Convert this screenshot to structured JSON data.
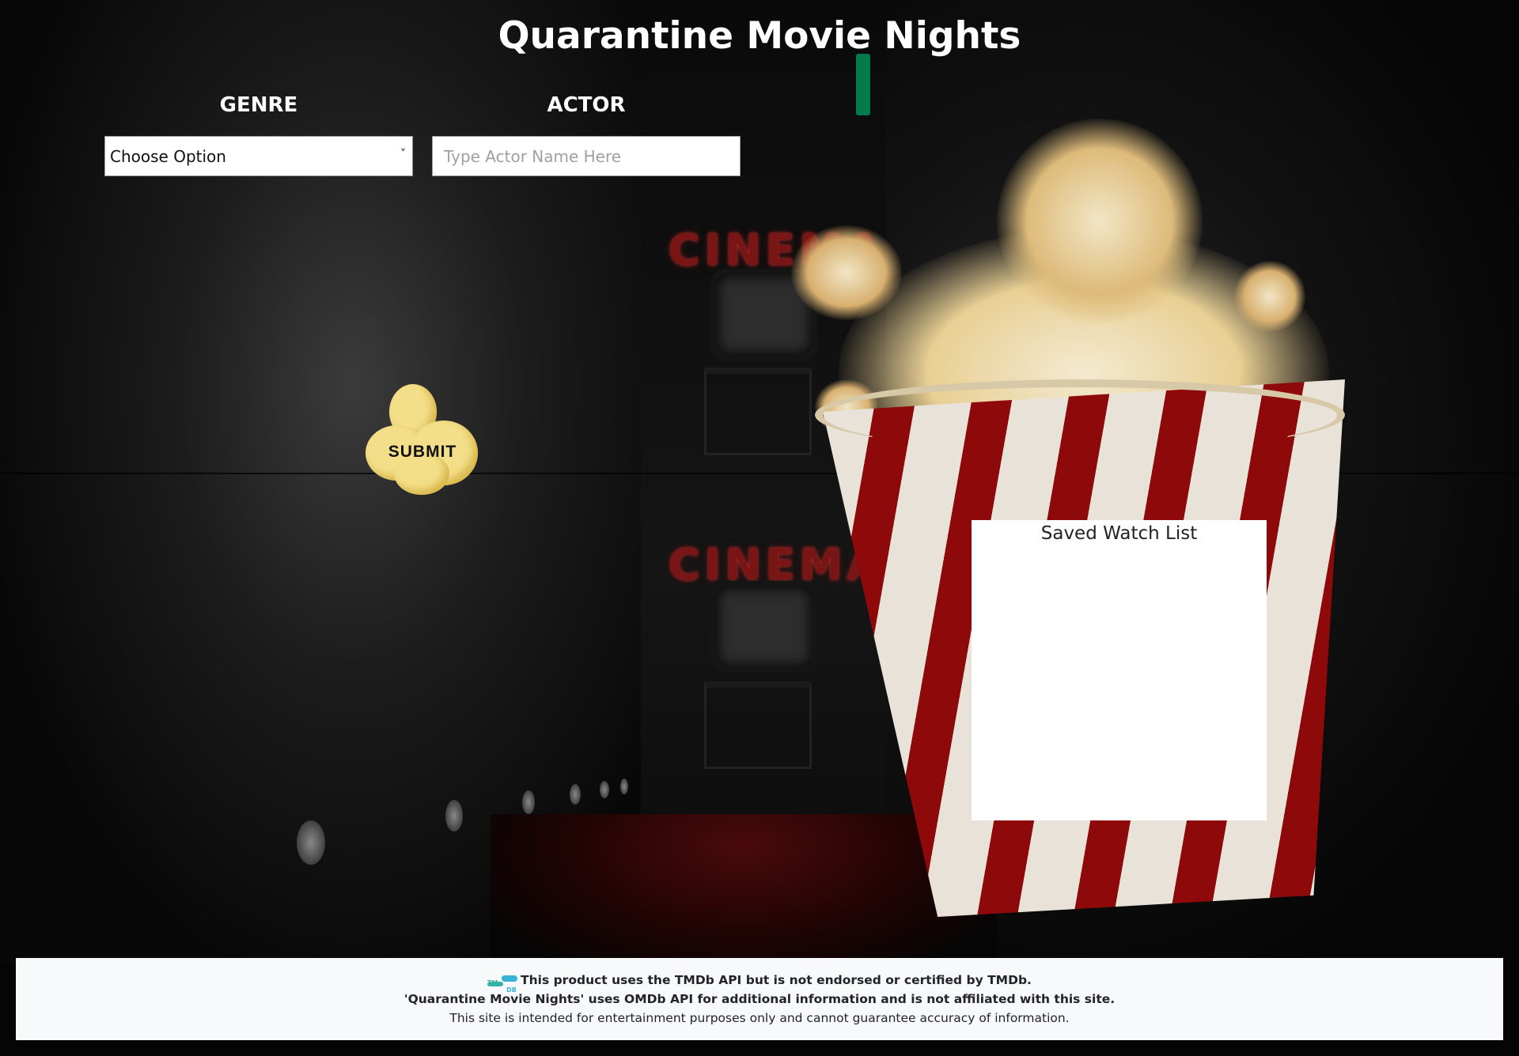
{
  "header": {
    "title": "Quarantine Movie Nights"
  },
  "genre": {
    "label": "GENRE",
    "selected": "Choose Option"
  },
  "actor": {
    "label": "ACTOR",
    "placeholder": "Type Actor Name Here",
    "value": ""
  },
  "submit": {
    "label": "SUBMIT"
  },
  "watchlist": {
    "title": "Saved Watch List"
  },
  "backdrop": {
    "sign_text": "CINEMA"
  },
  "footer": {
    "logo_text": "TMDB",
    "line1": "This product uses the TMDb API but is not endorsed or certified by TMDb.",
    "line2": "'Quarantine Movie Nights' uses OMDb API for additional information and is not affiliated with this site.",
    "line3": "This site is intended for entertainment purposes only and cannot guarantee accuracy of information."
  },
  "colors": {
    "background": "#050505",
    "stripe_red": "#8e0a0a",
    "stripe_cream": "#e9e2d8",
    "popcorn": "#f3df8a",
    "footer_bg": "#f8f9fa"
  }
}
